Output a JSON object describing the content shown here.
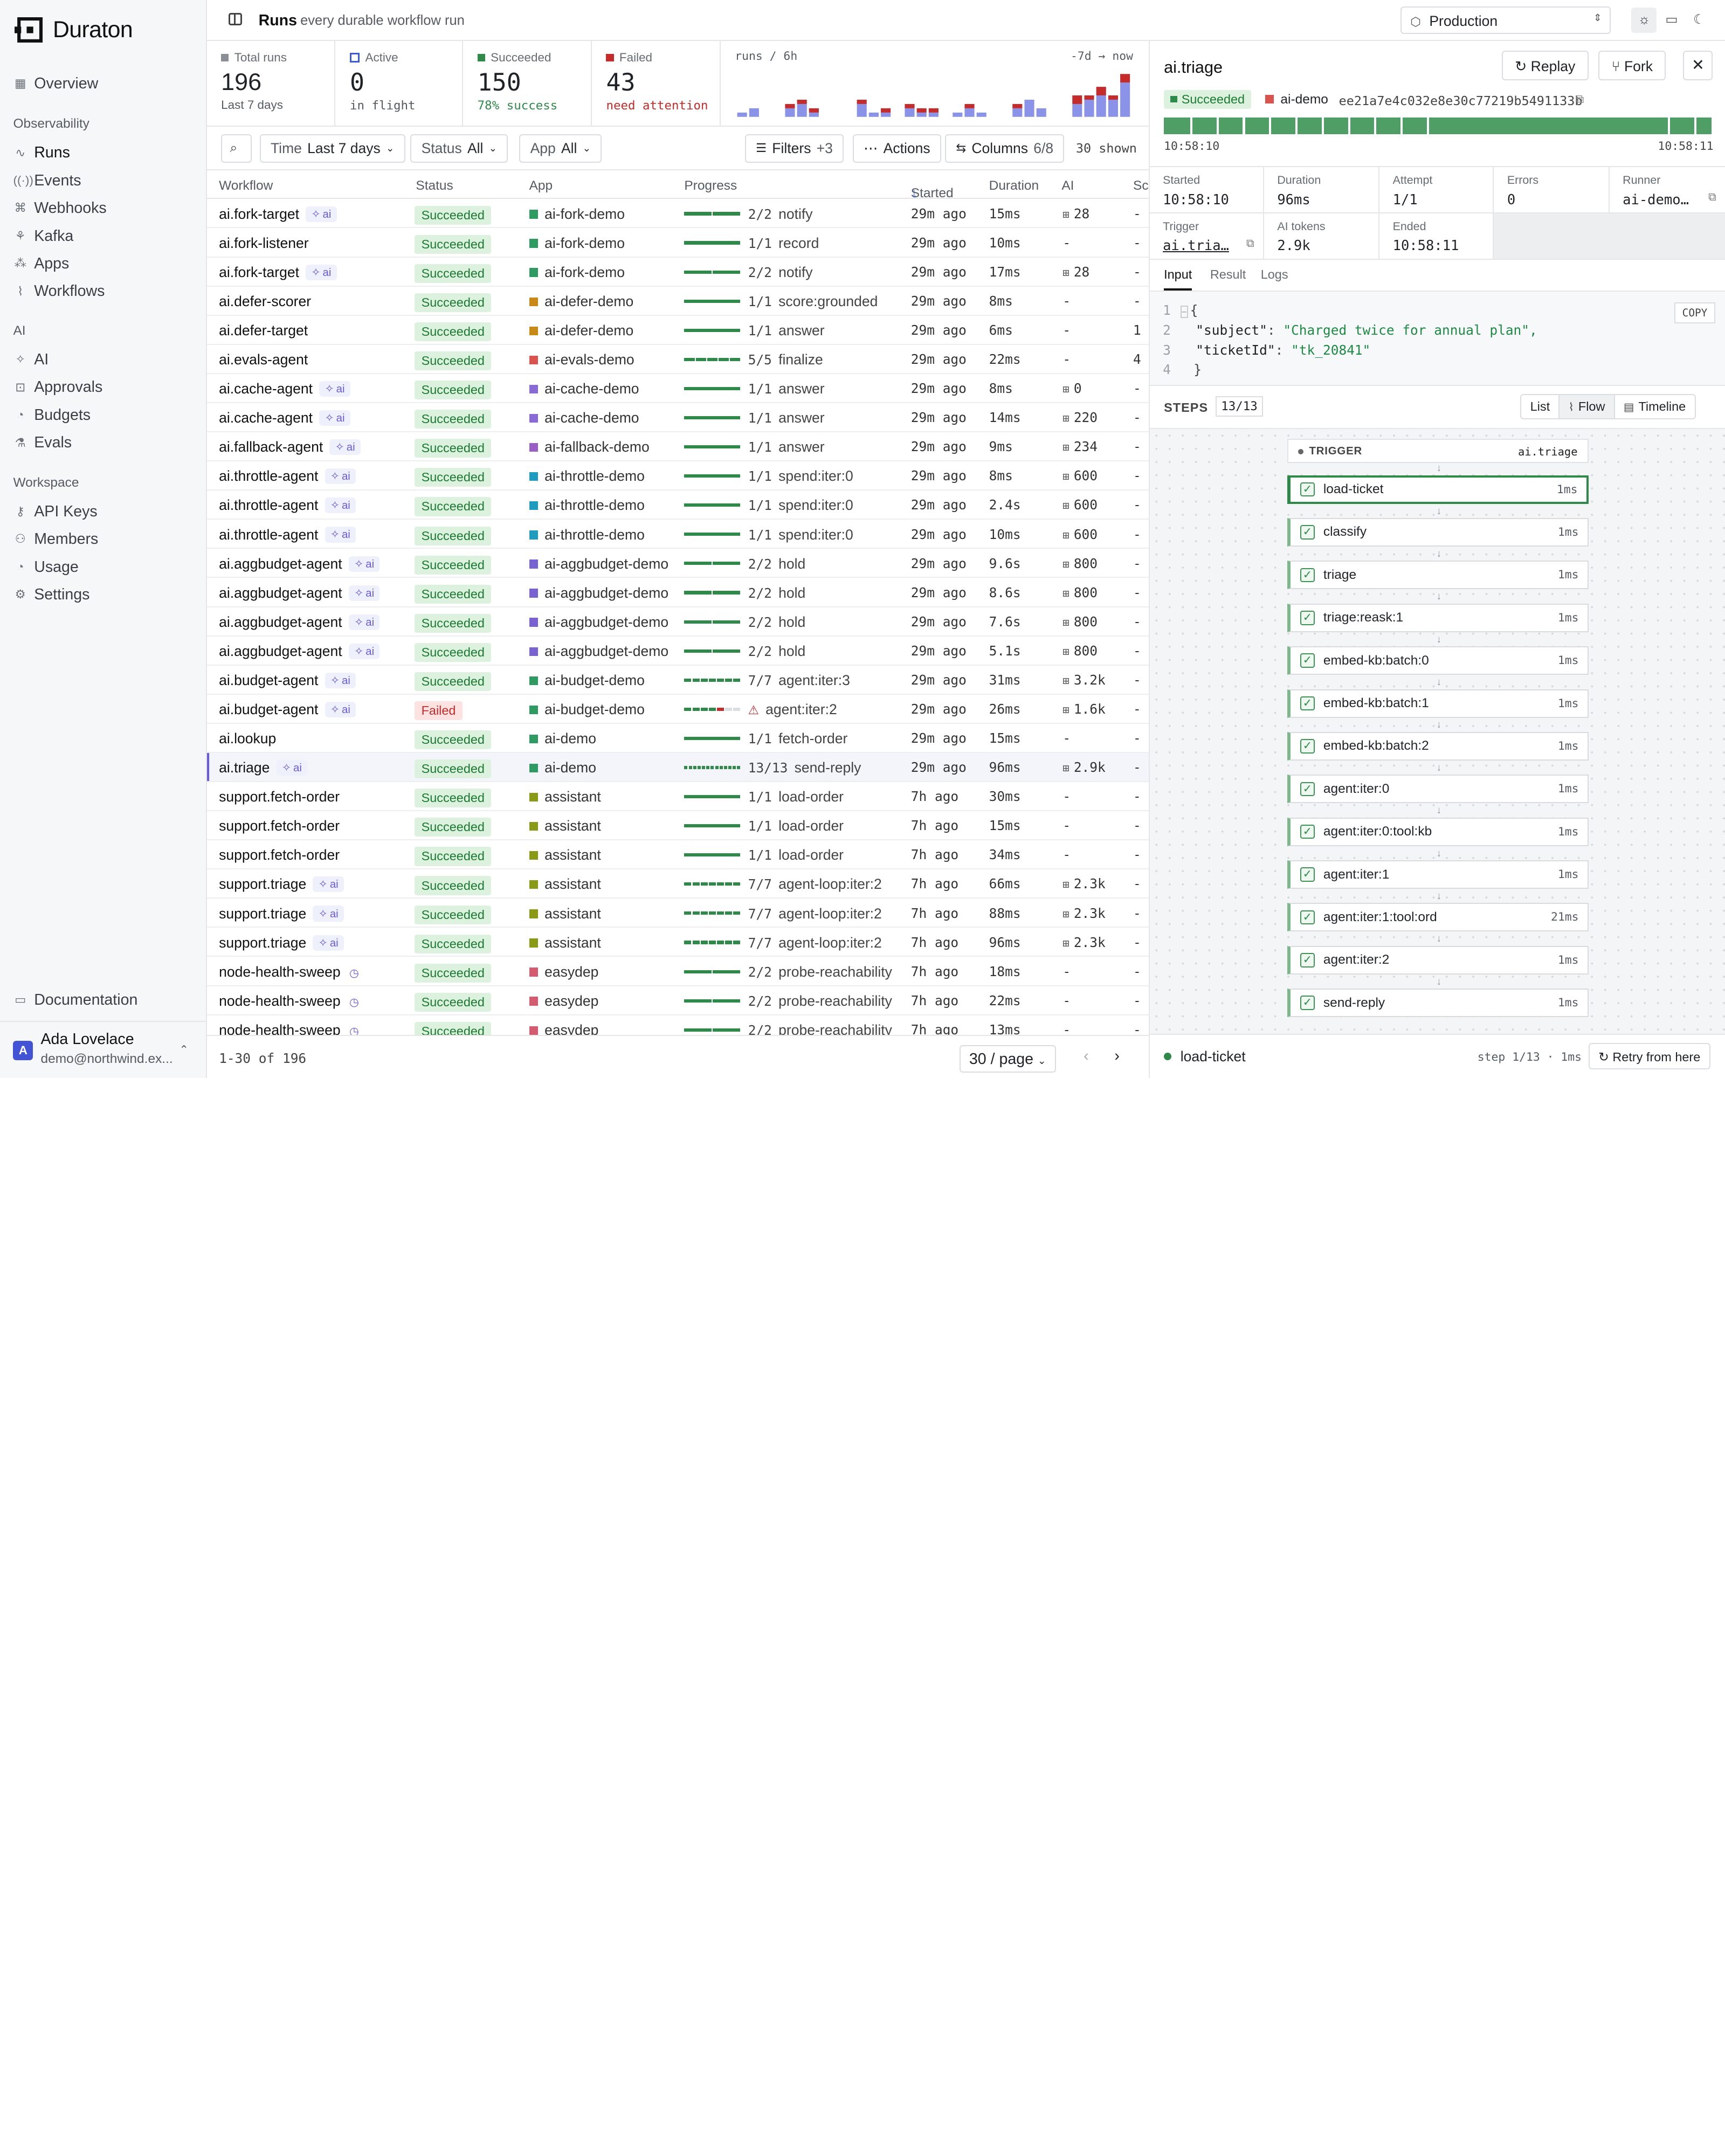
{
  "brand": {
    "name": "Duraton"
  },
  "sidebar": {
    "top": [
      {
        "label": "Overview",
        "icon": "grid-icon"
      }
    ],
    "sections": [
      {
        "title": "Observability",
        "items": [
          {
            "label": "Runs",
            "icon": "runs-icon",
            "active": true
          },
          {
            "label": "Events",
            "icon": "events-icon"
          },
          {
            "label": "Webhooks",
            "icon": "webhook-icon"
          },
          {
            "label": "Kafka",
            "icon": "kafka-icon"
          },
          {
            "label": "Apps",
            "icon": "apps-icon"
          },
          {
            "label": "Workflows",
            "icon": "workflows-icon"
          }
        ]
      },
      {
        "title": "AI",
        "items": [
          {
            "label": "AI",
            "icon": "sparkle-icon"
          },
          {
            "label": "Approvals",
            "icon": "approvals-icon"
          },
          {
            "label": "Budgets",
            "icon": "gauge-icon"
          },
          {
            "label": "Evals",
            "icon": "flask-icon"
          }
        ]
      },
      {
        "title": "Workspace",
        "items": [
          {
            "label": "API Keys",
            "icon": "key-icon"
          },
          {
            "label": "Members",
            "icon": "members-icon"
          },
          {
            "label": "Usage",
            "icon": "gauge-icon"
          },
          {
            "label": "Settings",
            "icon": "gear-icon"
          }
        ]
      }
    ],
    "documentation": "Documentation",
    "user": {
      "initial": "A",
      "name": "Ada Lovelace",
      "email": "demo@northwind.ex..."
    }
  },
  "topbar": {
    "title": "Runs",
    "subtitle": "every durable workflow run",
    "environment": "Production"
  },
  "stats": [
    {
      "label": "Total runs",
      "value": "196",
      "sub": "Last 7 days",
      "color": "#6b7178",
      "sub_color": "#555b62"
    },
    {
      "label": "Active",
      "value": "0",
      "sub": "in flight",
      "color": "#3b5bdb",
      "sub_color": "#555b62"
    },
    {
      "label": "Succeeded",
      "value": "150",
      "sub": "78% success",
      "color": "#2f8a4a",
      "sub_color": "#2f8a4a"
    },
    {
      "label": "Failed",
      "value": "43",
      "sub": "need attention",
      "color": "#c42b2b",
      "sub_color": "#c42b2b"
    }
  ],
  "histogram": {
    "label": "runs / 6h",
    "range": "-7d → now"
  },
  "chart_data": {
    "type": "bar",
    "stacked": true,
    "series": [
      {
        "name": "succeeded",
        "color": "#8b93e8",
        "values": [
          1,
          2,
          0,
          0,
          2,
          3,
          1,
          0,
          0,
          0,
          3,
          1,
          1,
          0,
          2,
          1,
          1,
          0,
          1,
          2,
          1,
          0,
          0,
          2,
          4,
          2,
          0,
          0,
          3,
          4,
          5,
          4,
          8
        ]
      },
      {
        "name": "failed",
        "color": "#c42b2b",
        "values": [
          0,
          0,
          0,
          0,
          1,
          1,
          1,
          0,
          0,
          0,
          1,
          0,
          1,
          0,
          1,
          1,
          1,
          0,
          0,
          1,
          0,
          0,
          0,
          1,
          0,
          0,
          0,
          0,
          2,
          1,
          2,
          1,
          2
        ]
      }
    ]
  },
  "filters": {
    "time_label": "Time",
    "time_value": "Last 7 days",
    "status_label": "Status",
    "status_value": "All",
    "app_label": "App",
    "app_value": "All",
    "filters_btn": "Filters",
    "filters_count": "+3",
    "actions_btn": "Actions",
    "columns_btn": "Columns",
    "columns_count": "6/8",
    "shown": "30 shown"
  },
  "table": {
    "headers": {
      "workflow": "Workflow",
      "status": "Status",
      "app": "App",
      "progress": "Progress",
      "started": "Started",
      "duration": "Duration",
      "ai": "AI",
      "sc": "Sc"
    },
    "rows": [
      {
        "wf": "ai.fork-target",
        "ai": true,
        "status": "Succeeded",
        "app": "ai-fork-demo",
        "app_color": "#2f9a62",
        "prog": "2/2",
        "step": "notify",
        "started": "29m ago",
        "dur": "15ms",
        "tokens": "28",
        "sc": "-"
      },
      {
        "wf": "ai.fork-listener",
        "ai": false,
        "status": "Succeeded",
        "app": "ai-fork-demo",
        "app_color": "#2f9a62",
        "prog": "1/1",
        "step": "record",
        "started": "29m ago",
        "dur": "10ms",
        "tokens": "-",
        "sc": "-"
      },
      {
        "wf": "ai.fork-target",
        "ai": true,
        "status": "Succeeded",
        "app": "ai-fork-demo",
        "app_color": "#2f9a62",
        "prog": "2/2",
        "step": "notify",
        "started": "29m ago",
        "dur": "17ms",
        "tokens": "28",
        "sc": "-"
      },
      {
        "wf": "ai.defer-scorer",
        "ai": false,
        "status": "Succeeded",
        "app": "ai-defer-demo",
        "app_color": "#c78a16",
        "prog": "1/1",
        "step": "score:grounded",
        "started": "29m ago",
        "dur": "8ms",
        "tokens": "-",
        "sc": "-"
      },
      {
        "wf": "ai.defer-target",
        "ai": false,
        "status": "Succeeded",
        "app": "ai-defer-demo",
        "app_color": "#c78a16",
        "prog": "1/1",
        "step": "answer",
        "started": "29m ago",
        "dur": "6ms",
        "tokens": "-",
        "sc": "1"
      },
      {
        "wf": "ai.evals-agent",
        "ai": false,
        "status": "Succeeded",
        "app": "ai-evals-demo",
        "app_color": "#d9534f",
        "prog": "5/5",
        "step": "finalize",
        "started": "29m ago",
        "dur": "22ms",
        "tokens": "-",
        "sc": "4"
      },
      {
        "wf": "ai.cache-agent",
        "ai": true,
        "status": "Succeeded",
        "app": "ai-cache-demo",
        "app_color": "#8a6bd6",
        "prog": "1/1",
        "step": "answer",
        "started": "29m ago",
        "dur": "8ms",
        "tokens": "0",
        "sc": "-"
      },
      {
        "wf": "ai.cache-agent",
        "ai": true,
        "status": "Succeeded",
        "app": "ai-cache-demo",
        "app_color": "#8a6bd6",
        "prog": "1/1",
        "step": "answer",
        "started": "29m ago",
        "dur": "14ms",
        "tokens": "220",
        "sc": "-"
      },
      {
        "wf": "ai.fallback-agent",
        "ai": true,
        "status": "Succeeded",
        "app": "ai-fallback-demo",
        "app_color": "#9a5fc4",
        "prog": "1/1",
        "step": "answer",
        "started": "29m ago",
        "dur": "9ms",
        "tokens": "234",
        "sc": "-"
      },
      {
        "wf": "ai.throttle-agent",
        "ai": true,
        "status": "Succeeded",
        "app": "ai-throttle-demo",
        "app_color": "#1f9bbf",
        "prog": "1/1",
        "step": "spend:iter:0",
        "started": "29m ago",
        "dur": "8ms",
        "tokens": "600",
        "sc": "-"
      },
      {
        "wf": "ai.throttle-agent",
        "ai": true,
        "status": "Succeeded",
        "app": "ai-throttle-demo",
        "app_color": "#1f9bbf",
        "prog": "1/1",
        "step": "spend:iter:0",
        "started": "29m ago",
        "dur": "2.4s",
        "tokens": "600",
        "sc": "-"
      },
      {
        "wf": "ai.throttle-agent",
        "ai": true,
        "status": "Succeeded",
        "app": "ai-throttle-demo",
        "app_color": "#1f9bbf",
        "prog": "1/1",
        "step": "spend:iter:0",
        "started": "29m ago",
        "dur": "10ms",
        "tokens": "600",
        "sc": "-"
      },
      {
        "wf": "ai.aggbudget-agent",
        "ai": true,
        "status": "Succeeded",
        "app": "ai-aggbudget-demo",
        "app_color": "#7a62d0",
        "prog": "2/2",
        "step": "hold",
        "started": "29m ago",
        "dur": "9.6s",
        "tokens": "800",
        "sc": "-"
      },
      {
        "wf": "ai.aggbudget-agent",
        "ai": true,
        "status": "Succeeded",
        "app": "ai-aggbudget-demo",
        "app_color": "#7a62d0",
        "prog": "2/2",
        "step": "hold",
        "started": "29m ago",
        "dur": "8.6s",
        "tokens": "800",
        "sc": "-"
      },
      {
        "wf": "ai.aggbudget-agent",
        "ai": true,
        "status": "Succeeded",
        "app": "ai-aggbudget-demo",
        "app_color": "#7a62d0",
        "prog": "2/2",
        "step": "hold",
        "started": "29m ago",
        "dur": "7.6s",
        "tokens": "800",
        "sc": "-"
      },
      {
        "wf": "ai.aggbudget-agent",
        "ai": true,
        "status": "Succeeded",
        "app": "ai-aggbudget-demo",
        "app_color": "#7a62d0",
        "prog": "2/2",
        "step": "hold",
        "started": "29m ago",
        "dur": "5.1s",
        "tokens": "800",
        "sc": "-"
      },
      {
        "wf": "ai.budget-agent",
        "ai": true,
        "status": "Succeeded",
        "app": "ai-budget-demo",
        "app_color": "#2f9a62",
        "prog": "7/7",
        "step": "agent:iter:3",
        "started": "29m ago",
        "dur": "31ms",
        "tokens": "3.2k",
        "sc": "-"
      },
      {
        "wf": "ai.budget-agent",
        "ai": true,
        "status": "Failed",
        "app": "ai-budget-demo",
        "app_color": "#2f9a62",
        "prog": "",
        "step": "agent:iter:2",
        "started": "29m ago",
        "dur": "26ms",
        "tokens": "1.6k",
        "sc": "-"
      },
      {
        "wf": "ai.lookup",
        "ai": false,
        "status": "Succeeded",
        "app": "ai-demo",
        "app_color": "#2f9a62",
        "prog": "1/1",
        "step": "fetch-order",
        "started": "29m ago",
        "dur": "15ms",
        "tokens": "-",
        "sc": "-"
      },
      {
        "wf": "ai.triage",
        "ai": true,
        "status": "Succeeded",
        "app": "ai-demo",
        "app_color": "#2f9a62",
        "prog": "13/13",
        "step": "send-reply",
        "started": "29m ago",
        "dur": "96ms",
        "tokens": "2.9k",
        "sc": "-",
        "selected": true
      },
      {
        "wf": "support.fetch-order",
        "ai": false,
        "status": "Succeeded",
        "app": "assistant",
        "app_color": "#8a9a16",
        "prog": "1/1",
        "step": "load-order",
        "started": "7h ago",
        "dur": "30ms",
        "tokens": "-",
        "sc": "-"
      },
      {
        "wf": "support.fetch-order",
        "ai": false,
        "status": "Succeeded",
        "app": "assistant",
        "app_color": "#8a9a16",
        "prog": "1/1",
        "step": "load-order",
        "started": "7h ago",
        "dur": "15ms",
        "tokens": "-",
        "sc": "-"
      },
      {
        "wf": "support.fetch-order",
        "ai": false,
        "status": "Succeeded",
        "app": "assistant",
        "app_color": "#8a9a16",
        "prog": "1/1",
        "step": "load-order",
        "started": "7h ago",
        "dur": "34ms",
        "tokens": "-",
        "sc": "-"
      },
      {
        "wf": "support.triage",
        "ai": true,
        "status": "Succeeded",
        "app": "assistant",
        "app_color": "#8a9a16",
        "prog": "7/7",
        "step": "agent-loop:iter:2",
        "started": "7h ago",
        "dur": "66ms",
        "tokens": "2.3k",
        "sc": "-"
      },
      {
        "wf": "support.triage",
        "ai": true,
        "status": "Succeeded",
        "app": "assistant",
        "app_color": "#8a9a16",
        "prog": "7/7",
        "step": "agent-loop:iter:2",
        "started": "7h ago",
        "dur": "88ms",
        "tokens": "2.3k",
        "sc": "-"
      },
      {
        "wf": "support.triage",
        "ai": true,
        "status": "Succeeded",
        "app": "assistant",
        "app_color": "#8a9a16",
        "prog": "7/7",
        "step": "agent-loop:iter:2",
        "started": "7h ago",
        "dur": "96ms",
        "tokens": "2.3k",
        "sc": "-"
      },
      {
        "wf": "node-health-sweep",
        "ai": false,
        "clock": true,
        "status": "Succeeded",
        "app": "easydep",
        "app_color": "#d45c70",
        "prog": "2/2",
        "step": "probe-reachability",
        "started": "7h ago",
        "dur": "18ms",
        "tokens": "-",
        "sc": "-"
      },
      {
        "wf": "node-health-sweep",
        "ai": false,
        "clock": true,
        "status": "Succeeded",
        "app": "easydep",
        "app_color": "#d45c70",
        "prog": "2/2",
        "step": "probe-reachability",
        "started": "7h ago",
        "dur": "22ms",
        "tokens": "-",
        "sc": "-"
      },
      {
        "wf": "node-health-sweep",
        "ai": false,
        "clock": true,
        "status": "Succeeded",
        "app": "easydep",
        "app_color": "#d45c70",
        "prog": "2/2",
        "step": "probe-reachability",
        "started": "7h ago",
        "dur": "13ms",
        "tokens": "-",
        "sc": "-"
      }
    ],
    "ai_tag": "ai",
    "footer": {
      "range": "1-30",
      "of": "of 196",
      "per_page": "30 / page"
    }
  },
  "panel": {
    "title": "ai.triage",
    "replay": "Replay",
    "fork": "Fork",
    "status": "Succeeded",
    "app": "ai-demo",
    "run_id": "ee21a7e4c032e8e30c77219b5491133b",
    "time_start": "10:58:10",
    "time_end": "10:58:11",
    "meta": [
      {
        "k": "Started",
        "v": "10:58:10"
      },
      {
        "k": "Duration",
        "v": "96ms"
      },
      {
        "k": "Attempt",
        "v": "1/1"
      },
      {
        "k": "Errors",
        "v": "0"
      },
      {
        "k": "Runner",
        "v": "ai-demo…"
      },
      {
        "k": "Trigger",
        "v": "ai.tria…"
      },
      {
        "k": "AI tokens",
        "v": "2.9k"
      },
      {
        "k": "Ended",
        "v": "10:58:11"
      }
    ],
    "tabs": [
      "Input",
      "Result",
      "Logs"
    ],
    "copy": "COPY",
    "code": [
      {
        "n": "1",
        "text": "{"
      },
      {
        "n": "2",
        "key": "\"subject\"",
        "val": "\"Charged twice for annual plan\","
      },
      {
        "n": "3",
        "key": "\"ticketId\"",
        "val": "\"tk_20841\""
      },
      {
        "n": "4",
        "text": "}"
      }
    ],
    "steps_label": "STEPS",
    "steps_count": "13/13",
    "views": [
      "List",
      "Flow",
      "Timeline"
    ],
    "trigger_label": "TRIGGER",
    "trigger_name": "ai.triage",
    "steps": [
      {
        "name": "load-ticket",
        "ms": "1ms"
      },
      {
        "name": "classify",
        "ms": "1ms"
      },
      {
        "name": "triage",
        "ms": "1ms"
      },
      {
        "name": "triage:reask:1",
        "ms": "1ms"
      },
      {
        "name": "embed-kb:batch:0",
        "ms": "1ms"
      },
      {
        "name": "embed-kb:batch:1",
        "ms": "1ms"
      },
      {
        "name": "embed-kb:batch:2",
        "ms": "1ms"
      },
      {
        "name": "agent:iter:0",
        "ms": "1ms"
      },
      {
        "name": "agent:iter:0:tool:kb",
        "ms": "1ms"
      },
      {
        "name": "agent:iter:1",
        "ms": "1ms"
      },
      {
        "name": "agent:iter:1:tool:ord",
        "ms": "21ms"
      },
      {
        "name": "agent:iter:2",
        "ms": "1ms"
      },
      {
        "name": "send-reply",
        "ms": "1ms"
      }
    ],
    "footer": {
      "step": "load-ticket",
      "info": "step 1/13 · 1ms",
      "retry": "Retry from here"
    }
  }
}
